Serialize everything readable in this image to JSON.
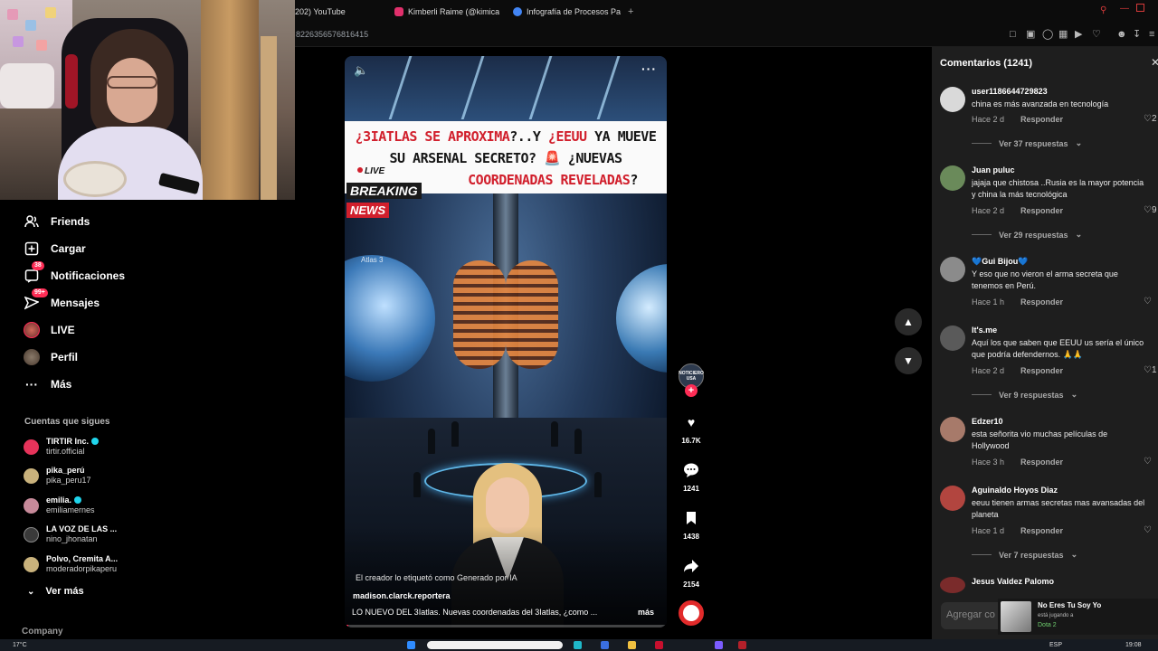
{
  "browser": {
    "tabs": [
      {
        "label": "202) YouTube",
        "color": "#ff0000"
      },
      {
        "label": "Kimberli Raime (@kimica",
        "color": "#e1306c"
      },
      {
        "label": "Infografía de Procesos Pa",
        "color": "#4285f4"
      }
    ],
    "new_tab": "+",
    "url": "8226356576816415"
  },
  "sidebar": {
    "items": [
      {
        "label": "Friends",
        "icon": "friends-icon",
        "glyph": "☺"
      },
      {
        "label": "Cargar",
        "icon": "upload-icon",
        "glyph": "⊞"
      },
      {
        "label": "Notificaciones",
        "icon": "notifications-icon",
        "glyph": "▢",
        "badge": "38"
      },
      {
        "label": "Mensajes",
        "icon": "messages-icon",
        "glyph": "▷",
        "badge": "99+"
      },
      {
        "label": "LIVE",
        "icon": "live-icon",
        "glyph": ""
      },
      {
        "label": "Perfil",
        "icon": "profile-icon",
        "glyph": ""
      },
      {
        "label": "Más",
        "icon": "more-icon",
        "glyph": "···"
      }
    ],
    "following_title": "Cuentas que sigues",
    "following": [
      {
        "name": "TIRTIR Inc.",
        "handle": "tirtir.official",
        "verified": true,
        "color": "#e6335a"
      },
      {
        "name": "pika_perú",
        "handle": "pika_peru17",
        "verified": false,
        "color": "#c9b27c"
      },
      {
        "name": "emilia.",
        "handle": "emiliamernes",
        "verified": true,
        "color": "#c78a9a"
      },
      {
        "name": "LA VOZ DE LAS ...",
        "handle": "nino_jhonatan",
        "verified": false,
        "color": "#3a3a3a"
      },
      {
        "name": "Polvo, Cremita A...",
        "handle": "moderadorpikaperu",
        "verified": false,
        "color": "#c9b27c"
      }
    ],
    "see_more": "Ver más",
    "company": "Company"
  },
  "video": {
    "headline_1a": "¿3IATLAS SE APROXIMA",
    "headline_1b": "?..Y ",
    "headline_1c": "¿EEUU",
    "headline_1d": " YA MUEVE",
    "headline_2": "SU ARSENAL SECRETO? 🚨 ¿NUEVAS",
    "headline_3": "COORDENADAS REVELADAS",
    "headline_3b": "?",
    "live": "LIVE",
    "breaking": "BREAKING",
    "news": "NEWS",
    "scene_label": "Atlas 3",
    "ai_label": "El creador lo etiquetó como Generado por IA",
    "author": "madison.clarck.reportera",
    "caption": "LO NUEVO DEL 3Iatlas. Nuevas coordenadas del 3Iatlas, ¿como ...",
    "more": "más",
    "progress": 0.01
  },
  "actions": {
    "creator": "NOTICIERO USA",
    "likes": "16.7K",
    "comments": "1241",
    "saves": "1438",
    "shares": "2154"
  },
  "comments": {
    "title": "Comentarios (1241)",
    "reply_label": "Responder",
    "input_placeholder": "Agregar co",
    "items": [
      {
        "user": "user1186644729823",
        "text": "china es más avanzada en tecnología",
        "text2": "",
        "time": "Hace 2 d",
        "likes": "2",
        "replies": "Ver 37 respuestas",
        "color": "#d9d9d9"
      },
      {
        "user": "Juan puluc",
        "text": "jajaja que chistosa ..Rusia es la mayor potencia",
        "text2": "y china la más tecnológica",
        "time": "Hace 2 d",
        "likes": "9",
        "replies": "Ver 29 respuestas",
        "color": "#6a8a5a"
      },
      {
        "user": "💙Gui Bijou💙",
        "text": "Y eso que no vieron el arma secreta que",
        "text2": "tenemos en Perú.",
        "time": "Hace 1 h",
        "likes": "",
        "replies": "",
        "color": "#8b8b8b"
      },
      {
        "user": "It's.me",
        "text": "Aquí los que saben que EEUU us sería el único",
        "text2": "que podría defendernos. 🙏🙏",
        "time": "Hace 2 d",
        "likes": "1",
        "replies": "Ver 9 respuestas",
        "color": "#5a5a5a"
      },
      {
        "user": "Edzer10",
        "text": "esta señorita vio muchas películas de",
        "text2": "Hollywood",
        "time": "Hace 3 h",
        "likes": "",
        "replies": "",
        "color": "#a77a6a"
      },
      {
        "user": "Aguinaldo Hoyos Diaz",
        "text": "eeuu tienen armas secretas mas avansadas del",
        "text2": "planeta",
        "time": "Hace 1 d",
        "likes": "",
        "replies": "Ver 7 respuestas",
        "color": "#b2453f"
      },
      {
        "user": "Jesus Valdez Palomo",
        "text": "",
        "text2": "",
        "time": "",
        "likes": "",
        "replies": "",
        "color": "#7a2b2b"
      }
    ]
  },
  "notification": {
    "title": "No Eres Tu Soy Yo",
    "status": "está jugando a",
    "game": "Dota 2"
  },
  "taskbar": {
    "weather": "17°C",
    "lang": "ESP",
    "time": "19:08"
  }
}
